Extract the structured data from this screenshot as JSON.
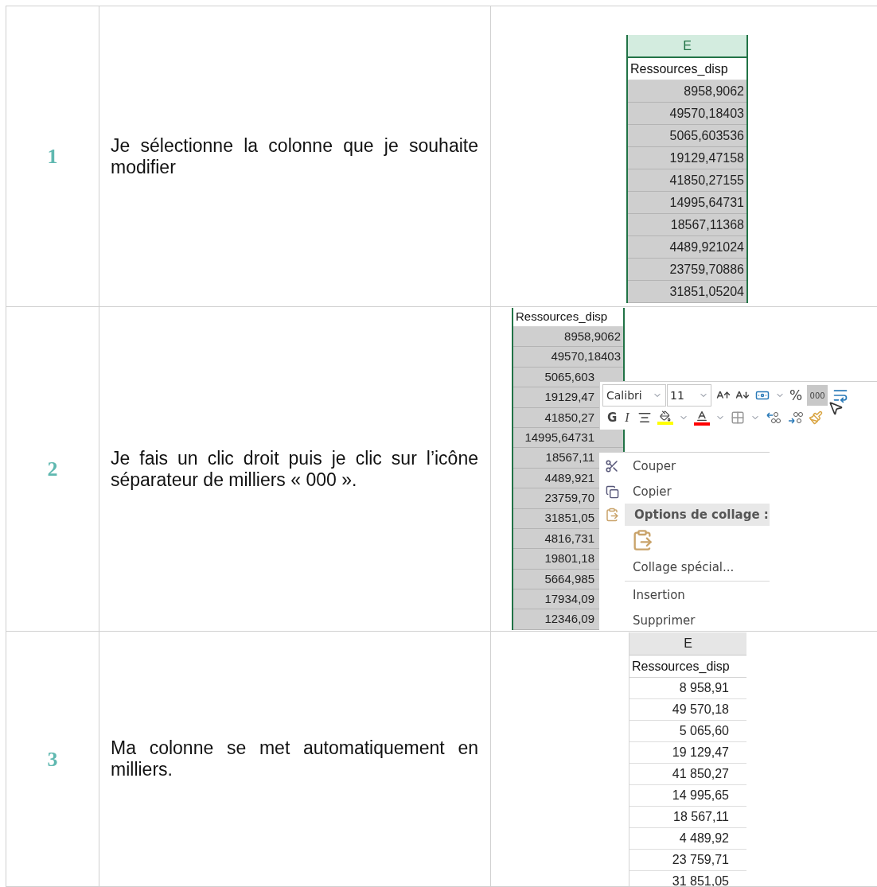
{
  "steps": [
    {
      "number": "1",
      "text": "Je sélectionne la colonne que je souhaite modifier",
      "excerpt": {
        "kind": "column",
        "column": {
          "letter": "E",
          "header_selected": true,
          "field": "Ressources_disp",
          "selected": true,
          "values": [
            "8958,9062",
            "49570,18403",
            "5065,603536",
            "19129,47158",
            "41850,27155",
            "14995,64731",
            "18567,11368",
            "4489,921024",
            "23759,70886",
            "31851,05204"
          ]
        }
      }
    },
    {
      "number": "2",
      "text": "Je fais un clic droit puis je clic sur l’icône séparateur de milliers « 000 ».",
      "excerpt": {
        "kind": "column_with_menu",
        "column": {
          "field": "Ressources_disp",
          "selected": true,
          "values": [
            "8958,9062",
            "49570,18403",
            "5065,603",
            "19129,47",
            "41850,27",
            "14995,64731",
            "18567,11",
            "4489,921",
            "23759,70",
            "31851,05",
            "4816,731",
            "19801,18",
            "5664,985",
            "17934,09",
            "12346,09"
          ]
        },
        "mini_toolbar": {
          "font": "Calibri",
          "size": "11",
          "percent": "%",
          "thousands": {
            "label": "000",
            "selected": true
          },
          "bold": "G",
          "italic": "I"
        },
        "context_menu": [
          {
            "kind": "cut",
            "label": "Couper"
          },
          {
            "kind": "copy",
            "label": "Copier"
          },
          {
            "kind": "heading",
            "label": "Options de collage :"
          },
          {
            "kind": "paste"
          },
          {
            "kind": "plain",
            "label": "Collage spécial..."
          },
          {
            "kind": "separator"
          },
          {
            "kind": "plain",
            "label": "Insertion"
          },
          {
            "kind": "plain",
            "label": "Supprimer"
          }
        ]
      }
    },
    {
      "number": "3",
      "text": "Ma colonne se met automatiquement en milliers.",
      "excerpt": {
        "kind": "column",
        "column": {
          "letter": "E",
          "header_selected": false,
          "field": "Ressources_disp",
          "selected": false,
          "values": [
            "8 958,91",
            "49 570,18",
            "5 065,60",
            "19 129,47",
            "41 850,27",
            "14 995,65",
            "18 567,11",
            "4 489,92",
            "23 759,71",
            "31 851,05"
          ]
        }
      }
    }
  ]
}
